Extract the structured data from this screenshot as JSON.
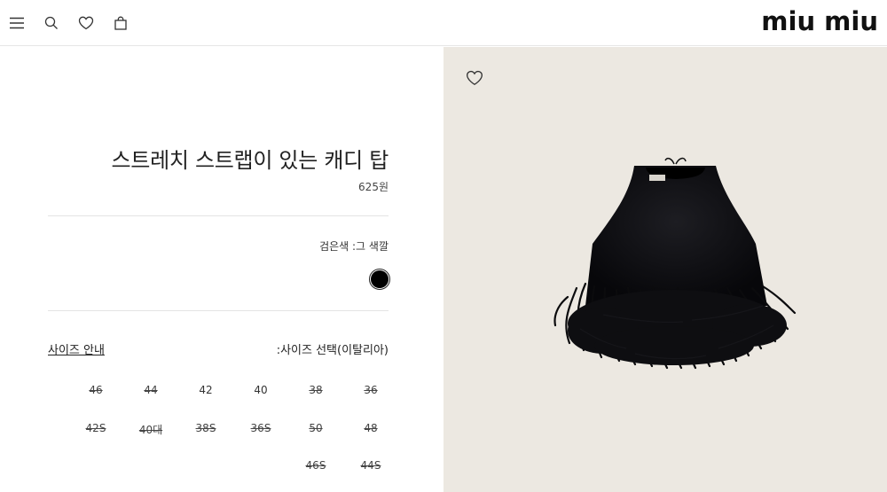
{
  "header": {
    "menu_icon": "menu-icon",
    "search_icon": "search-icon",
    "wishlist_icon": "heart-icon",
    "bag_icon": "shopping-bag-icon",
    "logo": "miu miu"
  },
  "product": {
    "title": "스트레치 스트랩이 있는 캐디 탑",
    "price": "625원",
    "color_label": "검은색 :그 색깔",
    "color_value": "#000000",
    "size_guide": "사이즈 안내",
    "size_select": ":사이즈 선택(이탈리아)",
    "sizes": [
      {
        "label": "46",
        "available": false
      },
      {
        "label": "44",
        "available": false
      },
      {
        "label": "42",
        "available": true
      },
      {
        "label": "40",
        "available": true
      },
      {
        "label": "38",
        "available": false
      },
      {
        "label": "36",
        "available": false
      },
      {
        "label": "42S",
        "available": false
      },
      {
        "label": "40대",
        "available": false
      },
      {
        "label": "38S",
        "available": false
      },
      {
        "label": "36S",
        "available": false
      },
      {
        "label": "50",
        "available": false
      },
      {
        "label": "48",
        "available": false
      },
      {
        "label": "46S",
        "available": false
      },
      {
        "label": "44S",
        "available": false
      }
    ]
  },
  "image": {
    "wishlist_icon": "heart-icon",
    "background": "#ece8e1"
  }
}
